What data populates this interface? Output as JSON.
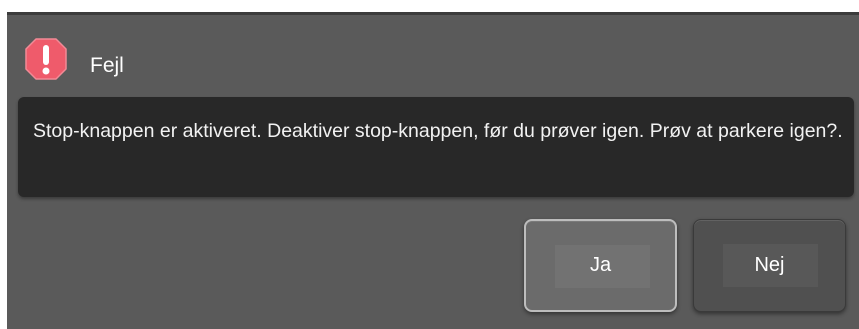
{
  "dialog": {
    "title": "Fejl",
    "icon": "alert-octagon-icon",
    "icon_color": "#ef5b6b",
    "message": "Stop-knappen er aktiveret. Deaktiver stop-knappen, før du prøver igen. Prøv at parkere igen?.",
    "buttons": {
      "yes_label": "Ja",
      "no_label": "Nej"
    }
  }
}
